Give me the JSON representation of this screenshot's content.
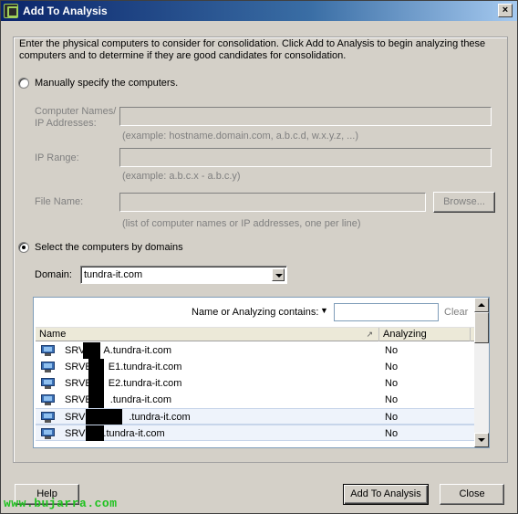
{
  "window": {
    "title": "Add To Analysis",
    "close_glyph": "×"
  },
  "intro_text": "Enter the physical computers to consider for consolidation. Click Add to Analysis to begin analyzing these computers and to determine if they are good candidates for consolidation.",
  "manual": {
    "label": "Manually specify the computers.",
    "names_label": "Computer Names/ IP Addresses:",
    "names_hint": "(example: hostname.domain.com, a.b.c.d, w.x.y.z, ...)",
    "ip_label": "IP Range:",
    "ip_hint": "(example: a.b.c.x - a.b.c.y)",
    "file_label": "File Name:",
    "browse_label": "Browse...",
    "file_hint": "(list of computer names or IP addresses, one per line)"
  },
  "domains": {
    "label": "Select the computers by domains",
    "domain_label": "Domain:",
    "domain_value": "tundra-it.com"
  },
  "list": {
    "filter_label": "Name or Analyzing contains:",
    "filter_value": "",
    "clear_label": "Clear",
    "col_name": "Name",
    "col_analyzing": "Analyzing",
    "rows": [
      {
        "name": "SRVA....A.tundra-it.com",
        "analyzing": "No"
      },
      {
        "name": "SRVE....E1.tundra-it.com",
        "analyzing": "No"
      },
      {
        "name": "SRVE....E2.tundra-it.com",
        "analyzing": "No"
      },
      {
        "name": "SRVE....tundra-it.com",
        "analyzing": "No"
      },
      {
        "name": "SRV.......tundra-it.com",
        "analyzing": "No"
      },
      {
        "name": "SRV.......tundra-it.com",
        "analyzing": "No"
      }
    ],
    "row_labels": [
      {
        "prefix": "SRV",
        "suffix": "A.tundra-it.com"
      },
      {
        "prefix": "SRVE",
        "suffix": "E1.tundra-it.com"
      },
      {
        "prefix": "SRVE",
        "suffix": "E2.tundra-it.com"
      },
      {
        "prefix": "SRVE",
        "suffix": ".tundra-it.com"
      },
      {
        "prefix": "SRVC",
        "suffix": ".tundra-it.com"
      },
      {
        "prefix": "SRV",
        "suffix": ".tundra-it.com"
      }
    ]
  },
  "buttons": {
    "help": "Help",
    "add": "Add To Analysis",
    "close": "Close"
  },
  "watermark": "www.bujarra.com"
}
